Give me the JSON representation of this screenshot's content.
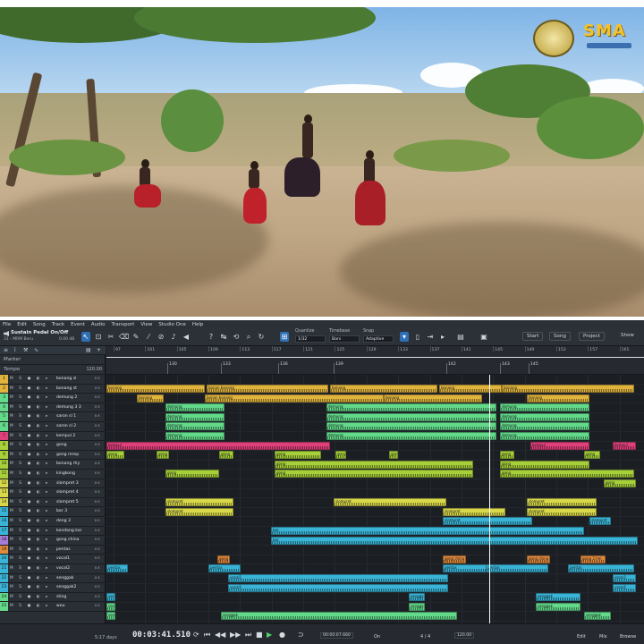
{
  "menu": [
    "File",
    "Edit",
    "Song",
    "Track",
    "Event",
    "Audio",
    "Transport",
    "View",
    "Studio One",
    "Help"
  ],
  "toolbar": {
    "instrument_name": "Sustain Pedal On/Off",
    "instrument_sub": "31 - MRM Beru",
    "instrument_value": "0.00 dB",
    "quantize_label": "Quantize",
    "quantize_value": "1/32",
    "timebase_label": "Timebase",
    "timebase_value": "Bars",
    "snap_label": "Snap",
    "snap_value": "Adaptive",
    "start": "Start",
    "song": "Song",
    "project": "Project",
    "show": "Show"
  },
  "track_panel": {
    "marker": "Marker",
    "tempo": "Tempo",
    "tempo_value": "120.00"
  },
  "tracks": [
    {
      "num": "1",
      "name": "bonang sl",
      "color": "#e0b43c"
    },
    {
      "num": "2",
      "name": "bonang st",
      "color": "#e0b43c"
    },
    {
      "num": "3",
      "name": "demung 2",
      "color": "#63d98a"
    },
    {
      "num": "4",
      "name": "demung 3 3",
      "color": "#63d98a"
    },
    {
      "num": "5",
      "name": "saron sl 1",
      "color": "#63d98a"
    },
    {
      "num": "6",
      "name": "saron sl 2",
      "color": "#63d98a"
    },
    {
      "num": "7",
      "name": "kempul 2",
      "color": "#e0407a"
    },
    {
      "num": "8",
      "name": "gong",
      "color": "#a6cf3a"
    },
    {
      "num": "9",
      "name": "gong rerep",
      "color": "#a6cf3a"
    },
    {
      "num": "10",
      "name": "bonang rhy",
      "color": "#a6cf3a"
    },
    {
      "num": "11",
      "name": "kingkong",
      "color": "#a6cf3a"
    },
    {
      "num": "12",
      "name": "slompret 3",
      "color": "#d8d84a"
    },
    {
      "num": "13",
      "name": "slompret 4",
      "color": "#d8d84a"
    },
    {
      "num": "14",
      "name": "slompret 5",
      "color": "#d8d84a"
    },
    {
      "num": "15",
      "name": "bar 3",
      "color": "#3ab4d6"
    },
    {
      "num": "16",
      "name": "deng 3",
      "color": "#3ab4d6"
    },
    {
      "num": "17",
      "name": "kendang kar",
      "color": "#3ab4d6"
    },
    {
      "num": "18",
      "name": "gong china",
      "color": "#a77cd9"
    },
    {
      "num": "19",
      "name": "pentas",
      "color": "#e08a3c"
    },
    {
      "num": "20",
      "name": "vocal1",
      "color": "#3ab4d6"
    },
    {
      "num": "21",
      "name": "vocal2",
      "color": "#3ab4d6"
    },
    {
      "num": "22",
      "name": "senggak",
      "color": "#3ab4d6"
    },
    {
      "num": "23",
      "name": "senggak2",
      "color": "#3ab4d6"
    },
    {
      "num": "24",
      "name": "sting",
      "color": "#63d98a"
    },
    {
      "num": "25",
      "name": "wou",
      "color": "#63d98a"
    }
  ],
  "ruler": {
    "bars": [
      "97",
      "101",
      "105",
      "109",
      "113",
      "117",
      "121",
      "125",
      "129",
      "133",
      "137",
      "141",
      "145",
      "149",
      "153",
      "157",
      "161"
    ],
    "markers": [
      "130",
      "133",
      "136",
      "139",
      "142",
      "143",
      "145"
    ]
  },
  "clip_labels": {
    "bonang": "bonang",
    "bonang_long": "bonan bonang",
    "demung": "demung",
    "kempul": "kempul",
    "gong": "gong",
    "slompret": "slompret",
    "bar": "bar",
    "gong_china": "gong china",
    "gong_chm": "gong 2.hm",
    "pentas": "pentas",
    "vocal": "vocal1",
    "senggak": "senggak"
  },
  "transport": {
    "status": "5:17 days",
    "time": "00:03:41.510",
    "position": "00:00:07.660",
    "meter": "4 / 4",
    "tempo": "120.00",
    "buttons": [
      "Edit",
      "Mix",
      "Browse"
    ]
  }
}
